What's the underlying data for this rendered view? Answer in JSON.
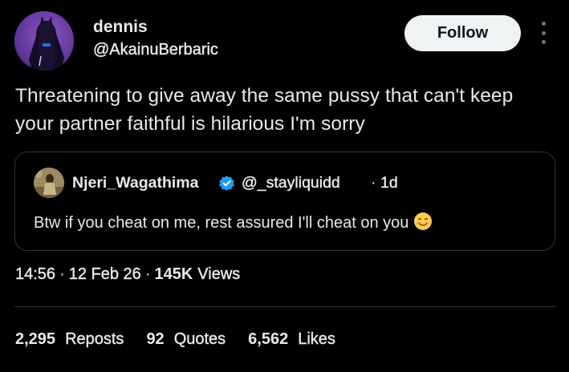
{
  "author": {
    "name": "dennis",
    "handle": "@AkainuBerbaric",
    "avatar_icon": "batman-avatar-icon"
  },
  "follow_label": "Follow",
  "tweet_text": "Threatening to give away the same pussy that can't keep your partner faithful is hilarious I'm sorry",
  "quoted": {
    "name": "Njeri_Wagathima",
    "verified": true,
    "handle": "@_stayliquidd",
    "separator": "·",
    "time": "1d",
    "text": "Btw if you cheat on me, rest assured I'll cheat on you",
    "emoji": "smiling-face-icon"
  },
  "meta": {
    "time": "14:56",
    "date": "12 Feb 26",
    "views_count": "145K",
    "views_label": "Views",
    "separator": "·"
  },
  "stats": {
    "reposts_count": "2,295",
    "reposts_label": "Reposts",
    "quotes_count": "92",
    "quotes_label": "Quotes",
    "likes_count": "6,562",
    "likes_label": "Likes"
  },
  "colors": {
    "background": "#000000",
    "text": "#e7e9ea",
    "muted": "#71767b",
    "border": "#2f3336",
    "verified": "#1d9bf0",
    "follow_bg": "#eff3f4"
  }
}
